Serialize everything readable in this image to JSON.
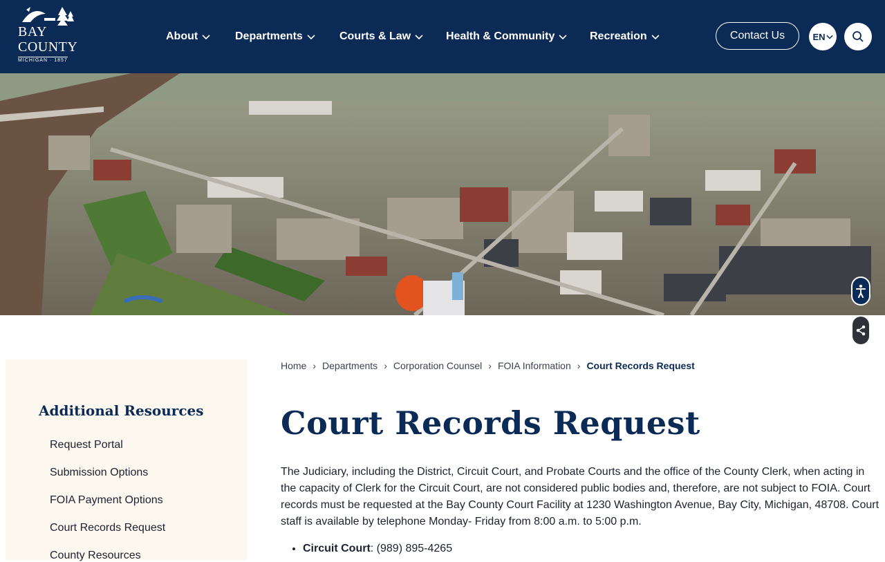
{
  "logo": {
    "line1": "BAY",
    "line2": "COUNTY",
    "line3": "MICHIGAN · 1857"
  },
  "nav": {
    "items": [
      {
        "label": "About"
      },
      {
        "label": "Departments"
      },
      {
        "label": "Courts & Law"
      },
      {
        "label": "Health & Community"
      },
      {
        "label": "Recreation"
      }
    ],
    "contact_label": "Contact Us",
    "language": "EN"
  },
  "sidebar": {
    "heading": "Additional Resources",
    "links": [
      {
        "label": "Request Portal"
      },
      {
        "label": "Submission Options"
      },
      {
        "label": "FOIA Payment Options"
      },
      {
        "label": "Court Records Request"
      },
      {
        "label": "County Resources"
      }
    ]
  },
  "breadcrumb": {
    "items": [
      "Home",
      "Departments",
      "Corporation Counsel",
      "FOIA Information"
    ],
    "current": "Court Records Request"
  },
  "main": {
    "title": "Court Records Request",
    "paragraph": "The Judiciary, including the District, Circuit Court, and Probate Courts and the office of the County Clerk, when acting in the capacity of Clerk for the Circuit Court, are not considered public bodies and, therefore, are not subject to FOIA. Court records must be requested at the Bay County Court Facility at 1230 Washington Avenue, Bay City, Michigan, 48708. Court staff is available by telephone Monday- Friday from 8:00 a.m. to 5:00 p.m.",
    "phones": [
      {
        "name": "Circuit Court",
        "number": ": (989) 895-4265"
      }
    ]
  },
  "colors": {
    "navy": "#0b2a55",
    "sidebar_bg": "#fdf8ef"
  }
}
